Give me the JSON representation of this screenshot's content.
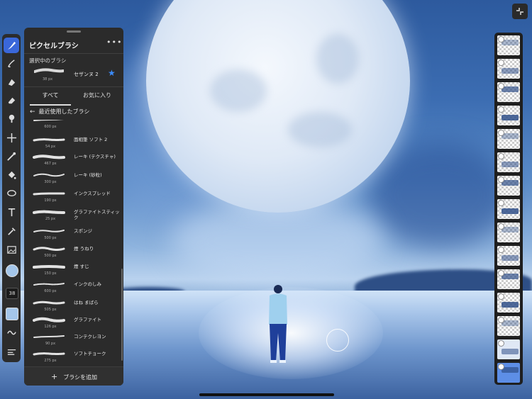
{
  "panel": {
    "title": "ピクセルブラシ",
    "more": "•••",
    "selected_label": "選択中のブラシ",
    "selected_brush": {
      "name": "セザンヌ 2",
      "size": "38 px"
    },
    "tabs": {
      "all": "すべて",
      "favorites": "お気に入り"
    },
    "section": "最近使用したブラシ",
    "brushes": [
      {
        "name": "",
        "size": "600 px"
      },
      {
        "name": "面相筆 ソフト 2",
        "size": "54 px"
      },
      {
        "name": "レーキ (テクスチャ)",
        "size": "467 px"
      },
      {
        "name": "レーキ (砂粒)",
        "size": "300 px"
      },
      {
        "name": "インクスプレッド",
        "size": "190 px"
      },
      {
        "name": "グラファイトスティック",
        "size": "25 px"
      },
      {
        "name": "スポンジ",
        "size": "500 px"
      },
      {
        "name": "煙 うねり",
        "size": "500 px"
      },
      {
        "name": "煙 すじ",
        "size": "150 px"
      },
      {
        "name": "インクのしみ",
        "size": "600 px"
      },
      {
        "name": "はね まばら",
        "size": "505 px"
      },
      {
        "name": "グラファイト",
        "size": "126 px"
      },
      {
        "name": "コンテクレヨン",
        "size": "90 px"
      },
      {
        "name": "ソフトチョーク",
        "size": "275 px"
      },
      {
        "name": "ウェットブラシ 2",
        "size": "175 px"
      }
    ],
    "add_label": "ブラシを追加"
  },
  "toolbar": {
    "size_value": "38",
    "tools": [
      "brush-icon",
      "smudge-icon",
      "fill-brush-icon",
      "eraser-icon",
      "blur-icon",
      "move-icon",
      "magic-wand-icon",
      "paint-bucket-icon",
      "lasso-icon",
      "text-icon",
      "eyedropper-icon",
      "image-icon"
    ],
    "current_color": "#a4c6ea"
  },
  "layers": {
    "count": 15
  }
}
